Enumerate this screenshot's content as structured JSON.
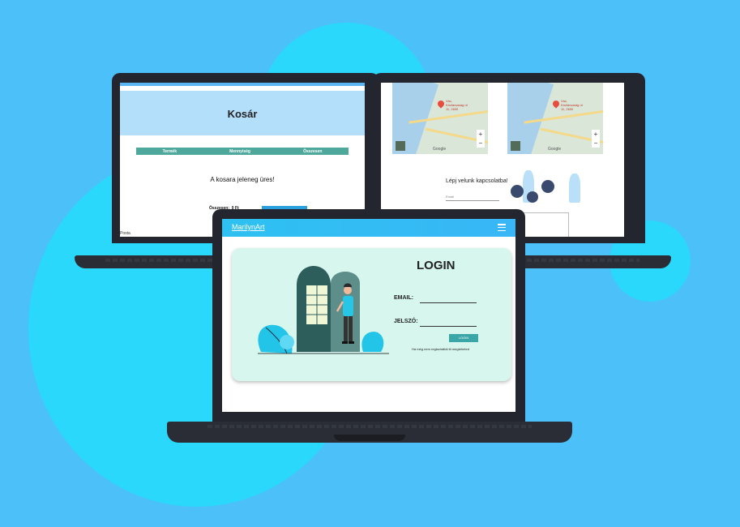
{
  "cart": {
    "title": "Kosár",
    "columns": [
      "Termék",
      "Mennyiség",
      "Összesen"
    ],
    "empty_message": "A kosara jeleneg üres!",
    "total_label": "Összesen:",
    "total_value": "0 Ft",
    "footer": "Posta"
  },
  "contact": {
    "maps": [
      {
        "pin_label": "Vác, Köztársaság út 11, 2600"
      },
      {
        "pin_label": "Vác, Köztársaság út 11, 2600"
      }
    ],
    "map_brand": "Google",
    "title": "Lépj velunk kapcsolatba!",
    "email_placeholder": "Email"
  },
  "login": {
    "brand": "MarilynArt",
    "title": "LOGIN",
    "email_label": "EMAIL:",
    "password_label": "JELSZÓ:",
    "button_label": "LOGIN",
    "register_text": "Ha még nem regisztráltál itt megteheted"
  },
  "colors": {
    "background": "#4cc0f8",
    "blob": "#29d8fb",
    "laptop": "#23262e",
    "card": "#d6f6ee",
    "accent": "#3aa6a8",
    "navbar": "#2ec1f1"
  }
}
